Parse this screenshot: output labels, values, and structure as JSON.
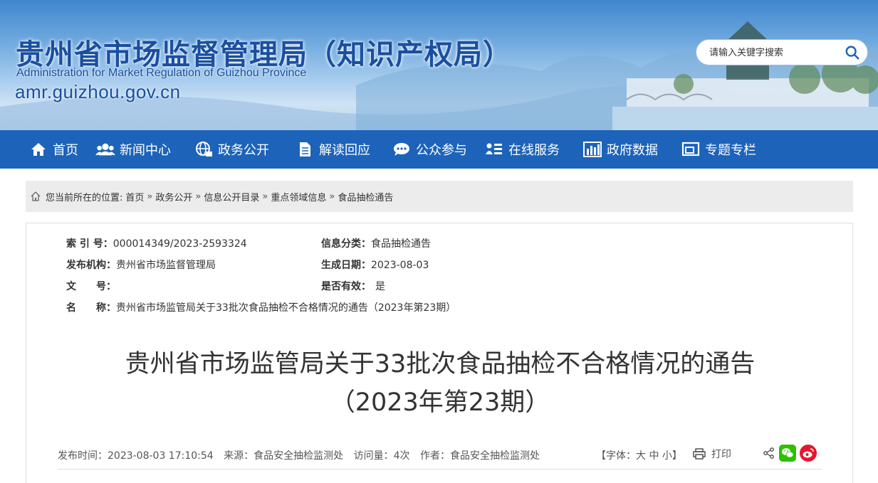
{
  "header": {
    "title": "贵州省市场监督管理局（知识产权局）",
    "title_en": "Administration for Market Regulation of Guizhou Province",
    "domain": "amr.guizhou.gov.cn",
    "search_placeholder": "请输入关键字搜索"
  },
  "nav": [
    {
      "label": "首页",
      "icon": "home-icon"
    },
    {
      "label": "新闻中心",
      "icon": "people-icon"
    },
    {
      "label": "政务公开",
      "icon": "globe-icon"
    },
    {
      "label": "解读回应",
      "icon": "document-icon"
    },
    {
      "label": "公众参与",
      "icon": "chat-icon"
    },
    {
      "label": "在线服务",
      "icon": "person-list-icon"
    },
    {
      "label": "政府数据",
      "icon": "bar-chart-icon"
    },
    {
      "label": "专题专栏",
      "icon": "window-icon"
    }
  ],
  "breadcrumb": {
    "prefix": "您当前所在的位置:",
    "items": [
      "首页",
      "政务公开",
      "信息公开目录",
      "重点领域信息",
      "食品抽检通告"
    ],
    "separator": "»"
  },
  "meta": {
    "index_label": "索 引 号：",
    "index_value": "000014349/2023-2593324",
    "category_label": "信息分类：",
    "category_value": "食品抽检通告",
    "publisher_label": "发布机构：",
    "publisher_value": "贵州省市场监督管理局",
    "date_label": "生成日期：",
    "date_value": "2023-08-03",
    "docno_label": "文　　号：",
    "docno_value": "",
    "valid_label": "是否有效：",
    "valid_value": "是",
    "name_label": "名　　称：",
    "name_value": "贵州省市场监管局关于33批次食品抽检不合格情况的通告（2023年第23期）"
  },
  "document": {
    "title_line1": "贵州省市场监管局关于33批次食品抽检不合格情况的通告",
    "title_line2": "（2023年第23期）"
  },
  "info": {
    "publish_time": "发布时间：2023-08-03 17:10:54",
    "source": "来源：食品安全抽检监测处",
    "visits": "访问量：4次",
    "author": "作者：食品安全抽检监测处",
    "font_open": "【字体：",
    "font_large": "大",
    "font_medium": "中",
    "font_small": "小",
    "font_close": "】",
    "print": "打印"
  },
  "colors": {
    "nav_bg": "#1d63b9",
    "title_blue": "#1a4fa0",
    "wechat_green": "#2dc100",
    "weibo_red": "#e6162d"
  }
}
